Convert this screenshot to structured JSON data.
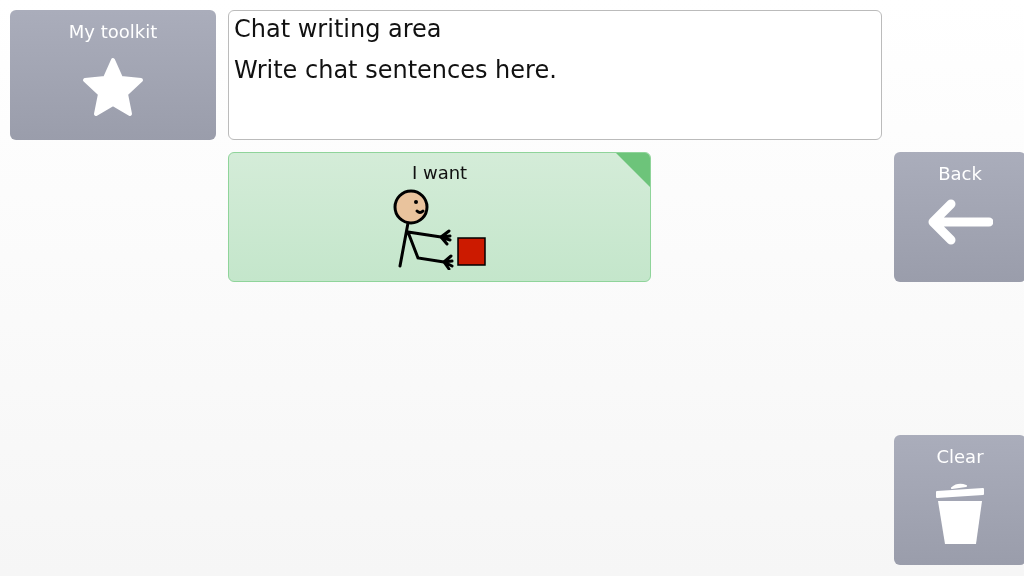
{
  "toolkit_button": {
    "label": "My toolkit"
  },
  "chat_area": {
    "title": "Chat writing area",
    "placeholder": "Write chat sentences here."
  },
  "cells": [
    {
      "label": "I want",
      "kind": "symbol",
      "corner_flag": true
    }
  ],
  "side_buttons": [
    {
      "label": "Back",
      "kind": "back"
    },
    {
      "label": "Clear",
      "kind": "clear"
    }
  ]
}
